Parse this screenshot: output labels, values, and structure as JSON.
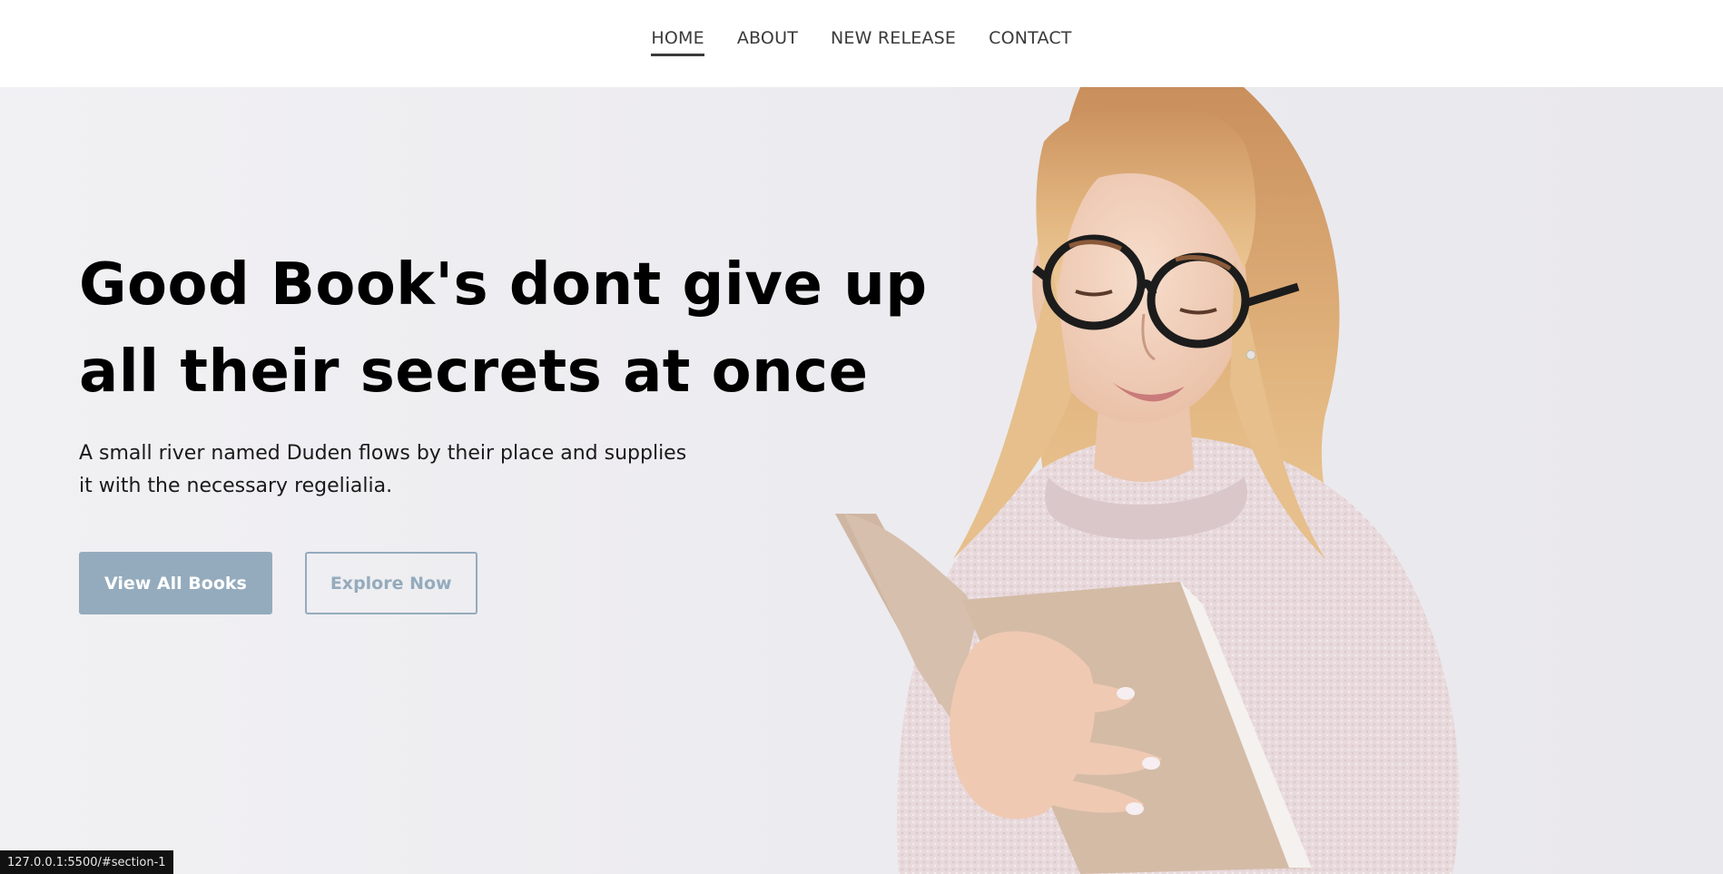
{
  "nav": {
    "items": [
      {
        "label": "HOME",
        "active": true
      },
      {
        "label": "ABOUT",
        "active": false
      },
      {
        "label": "NEW RELEASE",
        "active": false
      },
      {
        "label": "CONTACT",
        "active": false
      }
    ]
  },
  "hero": {
    "headline": "Good Book's dont give up all their secrets at once",
    "subtitle": "A small river named Duden flows by their place and supplies it with the necessary regelialia.",
    "primary_button": "View All Books",
    "secondary_button": "Explore Now"
  },
  "status_bar": {
    "url": "127.0.0.1:5500/#section-1"
  },
  "colors": {
    "accent": "#94abbd",
    "hero_bg": "#ecebef",
    "text": "#000000"
  }
}
